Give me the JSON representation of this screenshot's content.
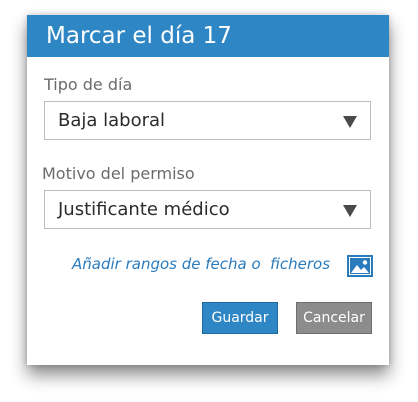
{
  "dialog": {
    "title": "Marcar el día 17",
    "day_type": {
      "label": "Tipo de día",
      "value": "Baja laboral"
    },
    "leave_reason": {
      "label": "Motivo del permiso",
      "value": "Justificante médico"
    },
    "add_link_text": "Añadir rangos de fecha o  ficheros",
    "save_label": "Guardar",
    "cancel_label": "Cancelar"
  },
  "icons": {
    "dropdown": "chevron-down-icon",
    "attachment": "image-icon"
  },
  "colors": {
    "accent": "#2f86c4",
    "link": "#2a7bbd",
    "cancel": "#8c8c8c"
  }
}
